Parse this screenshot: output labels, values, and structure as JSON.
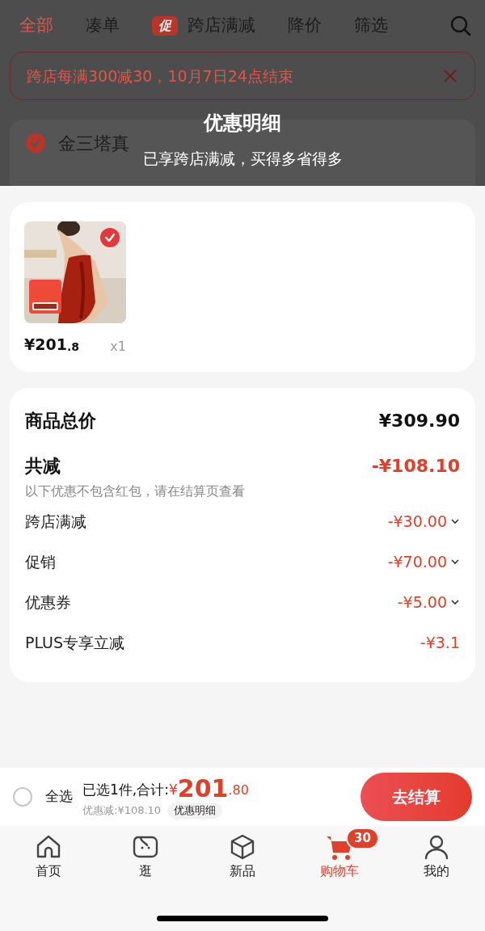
{
  "top_tabs": [
    {
      "label": "全部",
      "selected": true
    },
    {
      "label": "凑单",
      "selected": false
    },
    {
      "label": "跨店满减",
      "badge": "促",
      "selected": false
    },
    {
      "label": "降价",
      "selected": false
    },
    {
      "label": "筛选",
      "selected": false
    }
  ],
  "promo_banner": {
    "text": "跨店每满300减30，10月7日24点结束"
  },
  "store": {
    "name": "金三塔真",
    "checked": true
  },
  "sheet": {
    "title": "优惠明细",
    "subtitle": "已享跨店满减，买得多省得多"
  },
  "product": {
    "checked": true,
    "price_main": "¥201",
    "price_decimal": ".8",
    "quantity": "x1"
  },
  "summary": {
    "total_label": "商品总价",
    "total_value": "¥309.90",
    "discount_label": "共减",
    "discount_value": "-¥108.10",
    "note": "以下优惠不包含红包，请在结算页查看",
    "rows": [
      {
        "label": "跨店满减",
        "value": "-¥30.00",
        "expandable": true
      },
      {
        "label": "促销",
        "value": "-¥70.00",
        "expandable": true
      },
      {
        "label": "优惠券",
        "value": "-¥5.00",
        "expandable": true
      },
      {
        "label": "PLUS专享立减",
        "value": "-¥3.1",
        "expandable": false
      }
    ]
  },
  "checkout_bar": {
    "select_all": "全选",
    "select_all_checked": false,
    "selected_text": "已选1件,合计:",
    "currency": "¥",
    "amount_main": "201",
    "amount_decimal": ".80",
    "saved": "优惠减:¥108.10",
    "detail_link": "优惠明细",
    "checkout_button": "去结算"
  },
  "bottom_nav": [
    {
      "label": "首页",
      "kind": "home",
      "selected": false
    },
    {
      "label": "逛",
      "kind": "face",
      "selected": false
    },
    {
      "label": "新品",
      "kind": "box",
      "selected": false
    },
    {
      "label": "购物车",
      "kind": "cart",
      "badge": "30",
      "selected": true
    },
    {
      "label": "我的",
      "kind": "user",
      "selected": false
    }
  ]
}
